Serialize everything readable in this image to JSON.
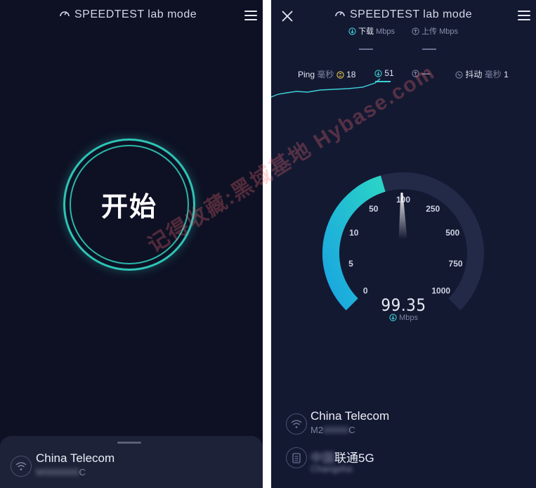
{
  "app": {
    "title": "SPEEDTEST lab mode"
  },
  "left": {
    "start_label": "开始",
    "isp": {
      "name": "China Telecom",
      "sub_blurred": "M",
      "sub_suffix": "C"
    }
  },
  "right": {
    "tabs": {
      "download_label": "下载",
      "download_unit": "Mbps",
      "upload_label": "上传",
      "upload_unit": "Mbps",
      "download_value": "—",
      "upload_value": "—"
    },
    "stats": {
      "ping_label": "Ping",
      "ping_unit": "毫秒",
      "ping_value": "18",
      "download_value": "51",
      "upload_value": "—",
      "jitter_label": "抖动",
      "jitter_unit": "毫秒",
      "jitter_value": "1"
    },
    "gauge": {
      "ticks": [
        "0",
        "5",
        "10",
        "50",
        "100",
        "250",
        "500",
        "750",
        "1000"
      ],
      "fill_fraction": 0.44,
      "needle_fraction": 0.495
    },
    "readout": {
      "value": "99.35",
      "unit": "Mbps"
    },
    "isp": {
      "name": "China Telecom",
      "sub_prefix": "M2",
      "sub_suffix": "C"
    },
    "network": {
      "name_suffix": "联通5G",
      "location_blurred": "Changsha"
    }
  },
  "watermark": "记得收藏:黑域基地 Hybase.com",
  "colors": {
    "accent": "#2ec4b6",
    "gauge_cyan": "#1fb5d6",
    "gauge_track": "#222a48",
    "background": "#0e1124"
  },
  "icons": [
    "speedometer-icon",
    "menu-icon",
    "close-icon",
    "download-icon",
    "upload-icon",
    "wifi-icon",
    "sim-icon"
  ]
}
